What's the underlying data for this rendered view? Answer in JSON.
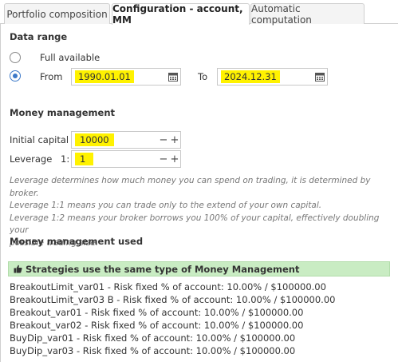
{
  "tabs": [
    {
      "label": "Portfolio composition"
    },
    {
      "label": "Configuration - account, MM"
    },
    {
      "label": "Automatic computation"
    }
  ],
  "data_range": {
    "title": "Data range",
    "full_available_label": "Full available",
    "from_label": "From",
    "from_value": "1990.01.01",
    "to_label": "To",
    "to_value": "2024.12.31",
    "selected": "from"
  },
  "money_management": {
    "title": "Money management",
    "initial_capital_label": "Initial capital",
    "initial_capital_value": "10000",
    "leverage_label": "Leverage",
    "leverage_prefix": "1:",
    "leverage_value": "1",
    "minus": "−",
    "plus": "+",
    "help_lines": [
      "Leverage determines how much money you can spend on trading, it is determined by broker.",
      "Leverage 1:1 means you can trade only to the extend of your own capital.",
      "Leverage 1:2 means your broker borrows you 100% of your capital, effectively doubling your",
      "possible trading size."
    ]
  },
  "mm_used": {
    "title": "Money management used",
    "banner": "Strategies use the same type of Money Management",
    "banner_color": "#c9ecc3",
    "strategies": [
      "BreakoutLimit_var01 - Risk fixed % of account: 10.00% / $100000.00",
      "BreakoutLimit_var03 B - Risk fixed % of account: 10.00% / $100000.00",
      "Breakout_var01 - Risk fixed % of account: 10.00% / $100000.00",
      "Breakout_var02 - Risk fixed % of account: 10.00% / $100000.00",
      "BuyDip_var01 - Risk fixed % of account: 10.00% / $100000.00",
      "BuyDip_var03 - Risk fixed % of account: 10.00% / $100000.00"
    ]
  },
  "highlight_color": "#fff200",
  "accent_color": "#3c78c8"
}
